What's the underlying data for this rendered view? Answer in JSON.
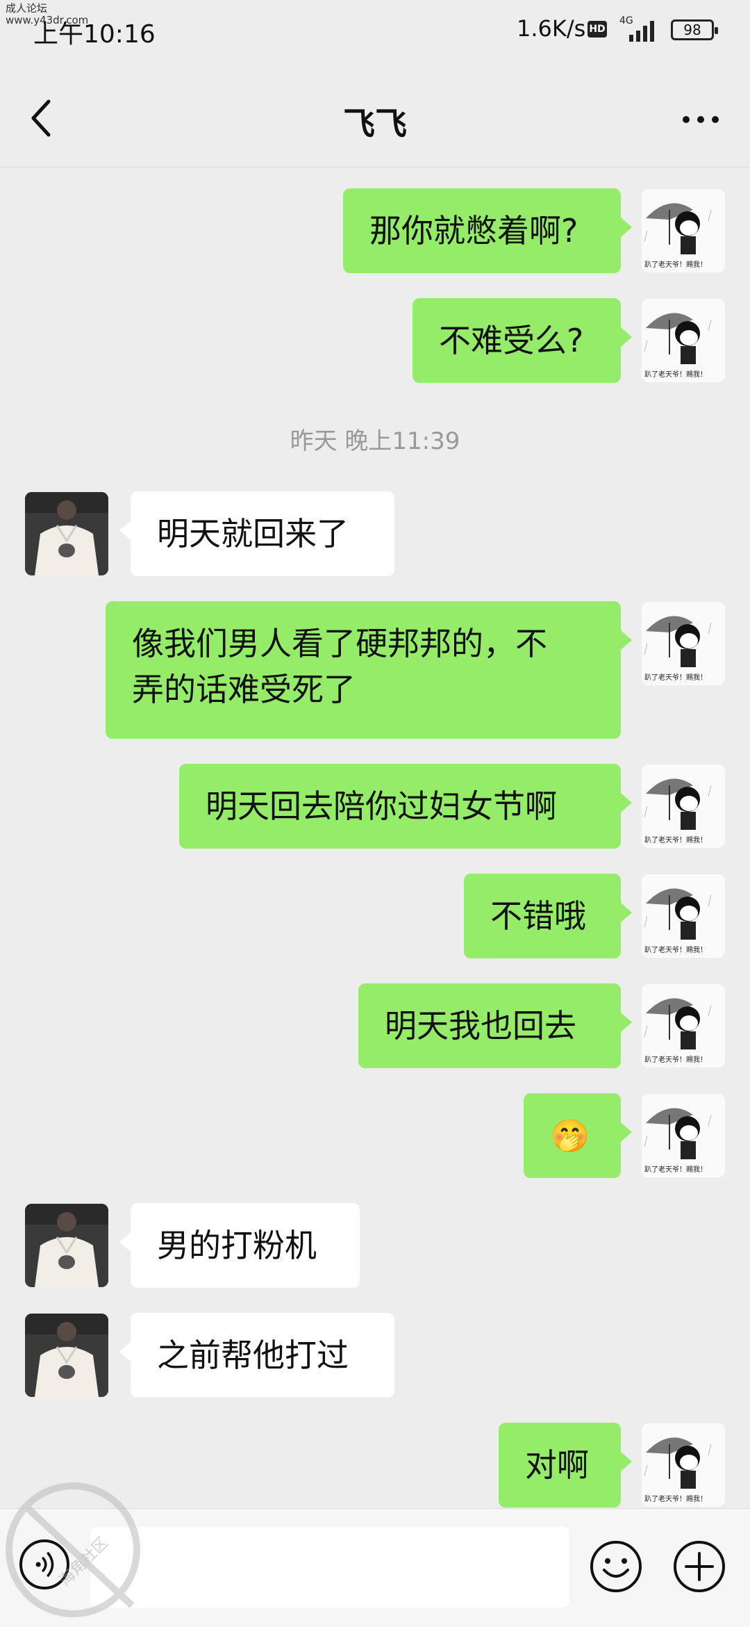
{
  "status_bar": {
    "time": "上午10:16",
    "watermark_line1": "成人论坛",
    "watermark_line2": "www.y43dr.com",
    "net_speed": "1.6K/s",
    "hd": "HD",
    "network": "4G",
    "battery": "98"
  },
  "header": {
    "title": "飞飞"
  },
  "messages": [
    {
      "from": "me",
      "text": "那你就憋着啊?"
    },
    {
      "from": "me",
      "text": "不难受么?"
    },
    {
      "timestamp": "昨天 晚上11:39"
    },
    {
      "from": "them",
      "text": "明天就回来了"
    },
    {
      "from": "me",
      "text": "像我们男人看了硬邦邦的，不\n弄的话难受死了"
    },
    {
      "from": "me",
      "text": "明天回去陪你过妇女节啊"
    },
    {
      "from": "me",
      "text": "不错哦"
    },
    {
      "from": "me",
      "text": "明天我也回去"
    },
    {
      "from": "me",
      "text": "🤭"
    },
    {
      "from": "them",
      "text": "男的打粉机"
    },
    {
      "from": "them",
      "text": "之前帮他打过"
    },
    {
      "from": "me",
      "text": "对啊"
    }
  ],
  "input_bar": {
    "placeholder": ""
  },
  "my_avatar_caption": "趴了老天爷！赐我！",
  "watermark_caption": "海角社区 haijiao.com",
  "colors": {
    "my_bubble": "#95ec69",
    "their_bubble": "#ffffff",
    "background": "#ededed"
  }
}
